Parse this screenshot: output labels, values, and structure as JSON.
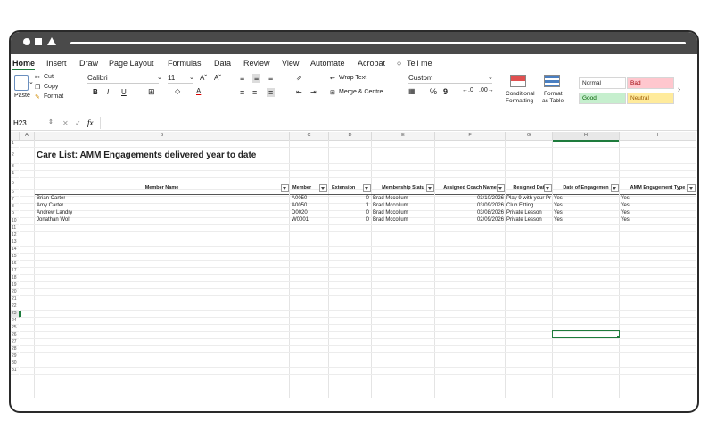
{
  "menu": {
    "items": [
      "Home",
      "Insert",
      "Draw",
      "Page Layout",
      "Formulas",
      "Data",
      "Review",
      "View",
      "Automate",
      "Acrobat"
    ],
    "tell_me": "Tell me"
  },
  "ribbon": {
    "paste": "Paste",
    "cut": "Cut",
    "copy": "Copy",
    "format": "Format",
    "font_name": "Calibri",
    "font_size": "11",
    "bold": "B",
    "italic": "I",
    "underline": "U",
    "wrap_text": "Wrap Text",
    "merge_centre": "Merge & Centre",
    "number_format": "Custom",
    "percent": "%",
    "comma": "9",
    "conditional": "Conditional",
    "formatting": "Formatting",
    "format_as": "Format",
    "as_table": "as Table",
    "styles": {
      "normal": "Normal",
      "bad": "Bad",
      "good": "Good",
      "neutral": "Neutral"
    }
  },
  "formula_bar": {
    "cell_ref": "H23",
    "fx": "fx"
  },
  "columns": [
    "A",
    "B",
    "C",
    "D",
    "E",
    "F",
    "G",
    "H",
    "I"
  ],
  "rows": [
    "1",
    "2",
    "3",
    "4",
    "5",
    "6",
    "7",
    "8",
    "9",
    "10",
    "11",
    "12",
    "13",
    "14",
    "15",
    "16",
    "17",
    "18",
    "19",
    "20",
    "21",
    "22",
    "23",
    "24",
    "25",
    "26",
    "27",
    "28",
    "29",
    "30",
    "31"
  ],
  "sheet": {
    "title": "Care List: AMM Engagements delivered year to date",
    "headers": [
      "Member Name",
      "Member",
      "Extension",
      "Membership Statu",
      "Assigned Coach Name",
      "Resigned Dat",
      "Date of Engagemen",
      "AMM Engagement Type"
    ],
    "data": [
      [
        "Brian Carter",
        "A0050",
        "0",
        "Brad Mccollum",
        "03/10/2026",
        "Play 9 with your Pr",
        "Yes",
        "Yes"
      ],
      [
        "Amy Carter",
        "A0050",
        "1",
        "Brad Mccollum",
        "03/09/2026",
        "Club Fitting",
        "Yes",
        "Yes"
      ],
      [
        "Andrew Landry",
        "D0020",
        "0",
        "Brad Mccollum",
        "03/08/2026",
        "Private Lesson",
        "Yes",
        "Yes"
      ],
      [
        "Jonathan Wolf",
        "W0001",
        "0",
        "Brad Mccollum",
        "02/09/2026",
        "Private Lesson",
        "Yes",
        "Yes"
      ]
    ]
  },
  "colors": {
    "accent": "#1e7b3c",
    "bad_bg": "#ffc7ce",
    "good_bg": "#c6efce",
    "neutral_bg": "#ffeb9c"
  }
}
